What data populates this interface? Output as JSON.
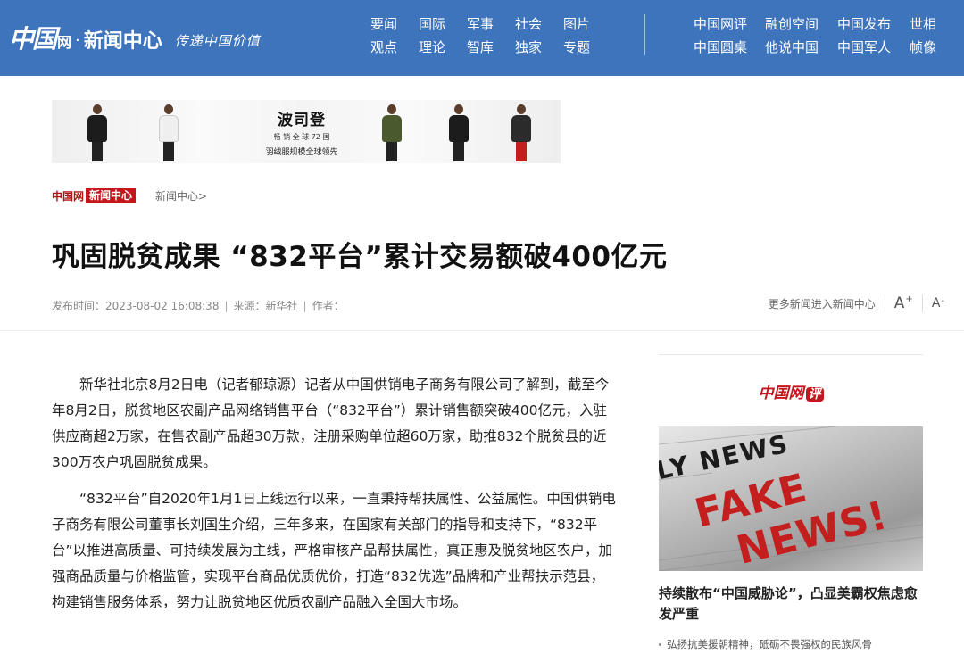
{
  "header": {
    "logo_mark": "中国",
    "logo_wang": "网",
    "logo_title": "新闻中心",
    "logo_slogan": "传递中国价值",
    "nav_main": [
      "要闻",
      "国际",
      "军事",
      "社会",
      "图片",
      "观点",
      "理论",
      "智库",
      "独家",
      "专题"
    ],
    "nav_extra": [
      "中国网评",
      "融创空间",
      "中国发布",
      "世相",
      "中国圆桌",
      "他说中国",
      "中国军人",
      "帧像"
    ]
  },
  "ad": {
    "brand": "波司登",
    "line1": "畅 销 全 球 72 国",
    "line2": "羽绒服规模全球领先"
  },
  "breadcrumb": {
    "site": "中国网",
    "tag": "新闻中心",
    "link": "新闻中心>"
  },
  "article": {
    "title": "巩固脱贫成果 “832平台”累计交易额破400亿元",
    "publish_label": "发布时间：2023-08-02 16:08:38",
    "source_label": "来源：新华社",
    "author_label": "作者：",
    "more_news": "更多新闻进入新闻中心",
    "font_increase": "A",
    "font_decrease": "A",
    "paragraphs": [
      "新华社北京8月2日电（记者郁琼源）记者从中国供销电子商务有限公司了解到，截至今年8月2日，脱贫地区农副产品网络销售平台（“832平台”）累计销售额突破400亿元，入驻供应商超2万家，在售农副产品超30万款，注册采购单位超60万家，助推832个脱贫县的近300万农户巩固脱贫成果。",
      "“832平台”自2020年1月1日上线运行以来，一直秉持帮扶属性、公益属性。中国供销电子商务有限公司董事长刘国生介绍，三年多来，在国家有关部门的指导和支持下，“832平台”以推进高质量、可持续发展为主线，严格审核产品帮扶属性，真正惠及脱贫地区农户，加强商品质量与价格监管，实现平台商品优质优价，打造“832优选”品牌和产业帮扶示范县，构建销售服务体系，努力让脱贫地区优质农副产品融入全国大市场。"
    ]
  },
  "sidebar": {
    "logo_text": "中国网",
    "logo_badge": "评",
    "image_top": "LY NEWS",
    "image_word1": "FAKE",
    "image_word2": "NEWS!",
    "headline": "持续散布“中国威胁论”，凸显美霸权焦虑愈发严重",
    "items": [
      "弘扬抗美援朝精神，砥砺不畏强权的民族风骨"
    ]
  },
  "colors": {
    "header_bg": "#3e74bc",
    "tag_red": "#c4161c"
  }
}
